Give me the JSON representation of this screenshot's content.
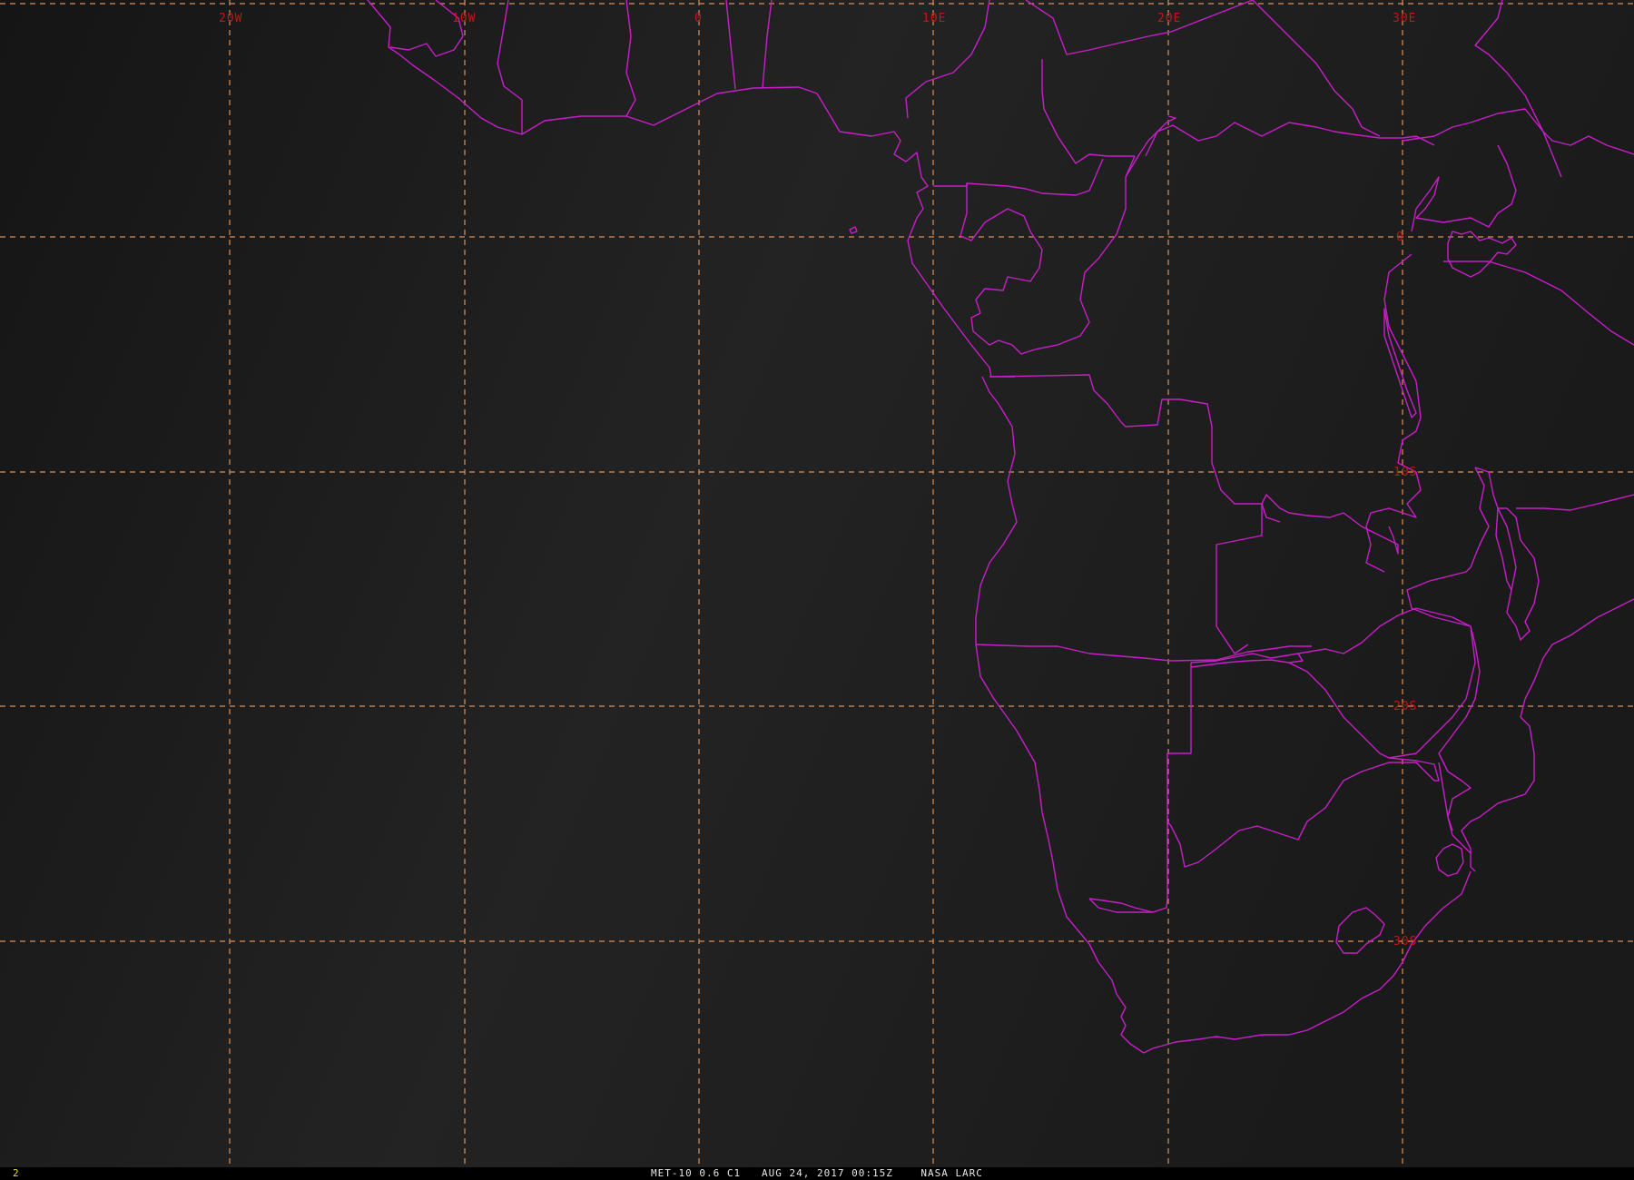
{
  "frame_number": "2",
  "caption": "MET-10 0.6 C1   AUG 24, 2017 00:15Z    NASA LARC",
  "longitude_labels": [
    "20W",
    "10W",
    "0",
    "10E",
    "20E",
    "30E"
  ],
  "latitude_labels": [
    "0",
    "10S",
    "20S",
    "30S"
  ],
  "colors": {
    "background": "#1c1c1c",
    "grid": "#d9915a",
    "grid_labels": "#c01818",
    "boundaries": "#c81ec8",
    "caption_text": "#e6e6e6",
    "frame_number": "#e8e030"
  }
}
